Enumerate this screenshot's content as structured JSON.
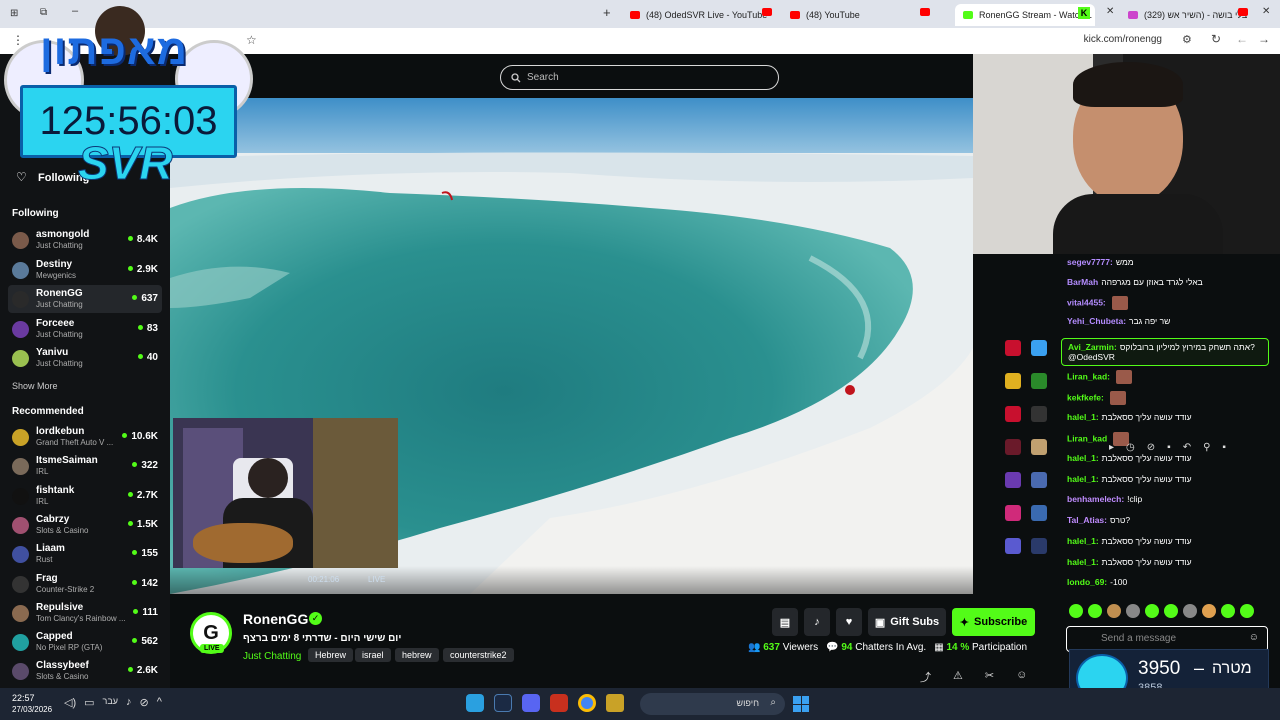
{
  "browser": {
    "tabs": [
      {
        "title": "(48) OdedSVR Live - YouTube",
        "favicon_color": "#ff0000"
      },
      {
        "title": "(48) YouTube",
        "favicon_color": "#ff0000"
      },
      {
        "title": "RonenGG Stream - Watch L",
        "favicon_color": "#53fc18"
      },
      {
        "title": "(329) בלי בושה - (השיר אש",
        "favicon_color": "#ff0000"
      }
    ],
    "url": "kick.com/ronengg"
  },
  "overlay": {
    "brand": "מאפתון",
    "timer": "125:56:03",
    "svr": "SVR"
  },
  "header": {
    "search_placeholder": "Search",
    "following_label": "Following"
  },
  "sidebar": {
    "following_title": "Following",
    "following": [
      {
        "name": "asmongold",
        "category": "Just Chatting",
        "viewers": "8.4K",
        "color": "#7a5a4a"
      },
      {
        "name": "Destiny",
        "category": "Mewgenics",
        "viewers": "2.9K",
        "color": "#5a7a9a"
      },
      {
        "name": "RonenGG",
        "category": "Just Chatting",
        "viewers": "637",
        "color": "#2a2a2a"
      },
      {
        "name": "Forceee",
        "category": "Just Chatting",
        "viewers": "83",
        "color": "#6a3aa0"
      },
      {
        "name": "Yanivu",
        "category": "Just Chatting",
        "viewers": "40",
        "color": "#9ac050"
      }
    ],
    "show_more": "Show More",
    "recommended_title": "Recommended",
    "recommended": [
      {
        "name": "lordkebun",
        "category": "Grand Theft Auto V ...",
        "viewers": "10.6K",
        "color": "#c9a227"
      },
      {
        "name": "ItsmeSaiman",
        "category": "IRL",
        "viewers": "322",
        "color": "#7a6a5a"
      },
      {
        "name": "fishtank",
        "category": "IRL",
        "viewers": "2.7K",
        "color": "#111111"
      },
      {
        "name": "Cabrzy",
        "category": "Slots & Casino",
        "viewers": "1.5K",
        "color": "#a05070"
      },
      {
        "name": "Liaam",
        "category": "Rust",
        "viewers": "155",
        "color": "#4050a0"
      },
      {
        "name": "Frag",
        "category": "Counter-Strike 2",
        "viewers": "142",
        "color": "#333333"
      },
      {
        "name": "Repulsive",
        "category": "Tom Clancy's Rainbow ...",
        "viewers": "111",
        "color": "#8a6a50"
      },
      {
        "name": "Capped",
        "category": "No Pixel RP (GTA)",
        "viewers": "562",
        "color": "#20a0a0"
      },
      {
        "name": "Classybeef",
        "category": "Slots & Casino",
        "viewers": "2.6K",
        "color": "#5a4a6a"
      }
    ]
  },
  "video": {
    "time_label": "00:21:06",
    "live_label": "LIVE"
  },
  "chat": {
    "messages": [
      {
        "user": "segev7777:",
        "text": "ממש",
        "color": "#b48cff"
      },
      {
        "user": "BarMah",
        "text": "באלי לגרד באוזן עם מגרפהה",
        "color": "#b48cff"
      },
      {
        "user": "vital4455:",
        "text": "",
        "color": "#b48cff"
      },
      {
        "user": "Yehi_Chubeta:",
        "text": "שר יפה גבר",
        "color": "#b48cff"
      },
      {
        "user": "Avi_Zarmin:",
        "text": "אתה תשחק במירוץ למיליון ברובלוקס?",
        "text2": "@OdedSVR",
        "color": "#53fc18",
        "highlight": true
      },
      {
        "user": "Liran_kad:",
        "text": "",
        "color": "#53fc18"
      },
      {
        "user": "kekfkefe:",
        "text": "",
        "color": "#53fc18"
      },
      {
        "user": "halel_1:",
        "text": "עודד עושה עליך ססאלבת",
        "color": "#53fc18"
      },
      {
        "user": "Liran_kad",
        "text": "",
        "color": "#53fc18"
      },
      {
        "user": "halel_1:",
        "text": "עודד עושה עליך ססאלבת",
        "color": "#53fc18"
      },
      {
        "user": "halel_1:",
        "text": "עודד עושה עליך ססאלבת",
        "color": "#53fc18"
      },
      {
        "user": "benhamelech:",
        "text": "!clip",
        "color": "#c08cff"
      },
      {
        "user": "Tal_Atias:",
        "text": "טרס?",
        "color": "#c08cff"
      },
      {
        "user": "halel_1:",
        "text": "עודד עושה עליך ססאלבת",
        "color": "#53fc18"
      },
      {
        "user": "halel_1:",
        "text": "עודד עושה עליך ססאלבת",
        "color": "#53fc18"
      },
      {
        "user": "londo_69:",
        "text": "-100",
        "color": "#53fc18"
      }
    ],
    "input_placeholder": "Send a message"
  },
  "stream": {
    "channel": "RonenGG",
    "title": "יום שישי היום - שדרתי 8 ימים ברצף",
    "category": "Just Chatting",
    "tags": [
      "Hebrew",
      "israel",
      "hebrew",
      "counterstrike2"
    ],
    "live_badge": "LIVE",
    "gift_label": "Gift Subs",
    "subscribe_label": "Subscribe",
    "viewers": "637",
    "viewers_label": "Viewers",
    "chatters": "94",
    "chatters_label": "Chatters In Avg.",
    "participation": "14 %",
    "participation_label": "Participation"
  },
  "goal": {
    "label": "מטרה",
    "current": "3950",
    "dash": "–",
    "sub": "3858"
  },
  "taskbar": {
    "time": "22:57",
    "date": "27/03/2026",
    "lang": "עבר",
    "search": "חיפוש"
  }
}
